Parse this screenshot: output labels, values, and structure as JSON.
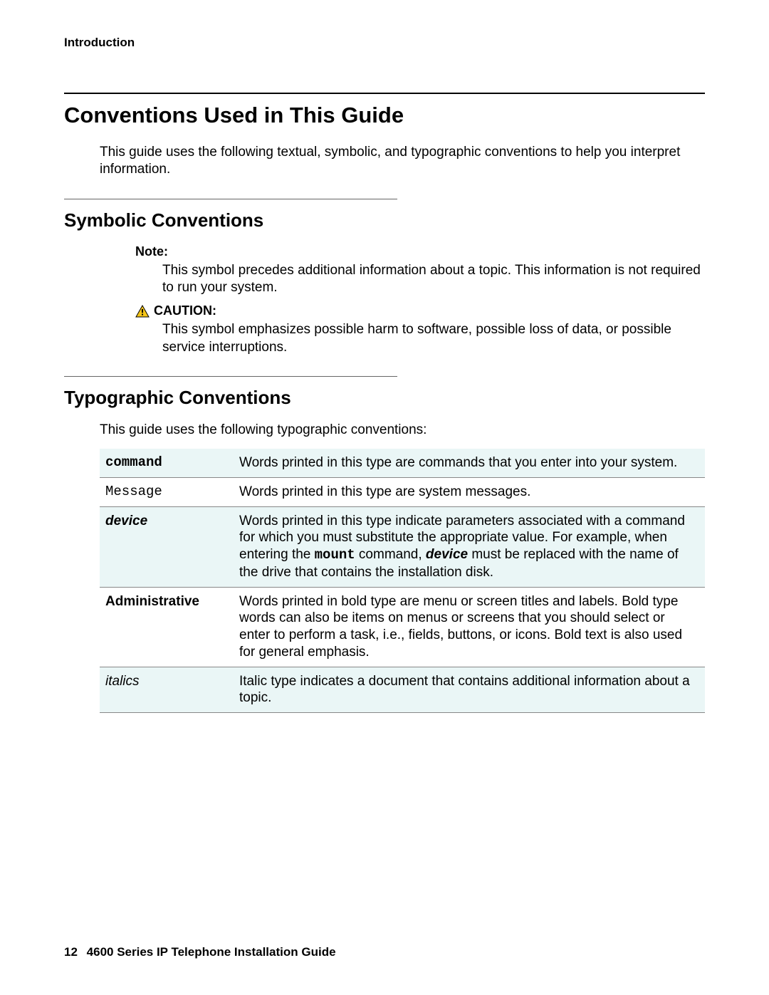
{
  "header": {
    "running": "Introduction"
  },
  "section": {
    "title": "Conventions Used in This Guide",
    "intro": "This guide uses the following textual, symbolic, and typographic conventions to help you interpret information."
  },
  "symbolic": {
    "title": "Symbolic Conventions",
    "note": {
      "label": "Note:",
      "text": "This symbol precedes additional information about a topic. This information is not required to run your system."
    },
    "caution": {
      "label": "CAUTION:",
      "text": "This symbol emphasizes possible harm to software, possible loss of data, or possible service interruptions."
    }
  },
  "typographic": {
    "title": "Typographic Conventions",
    "intro": "This guide uses the following typographic conventions:",
    "rows": [
      {
        "term": "command",
        "desc": "Words printed in this type are commands that you enter into your system."
      },
      {
        "term": "Message",
        "desc": "Words printed in this type are system messages."
      },
      {
        "term": "device",
        "desc_pre": "Words printed in this type indicate parameters associated with a command for which you must substitute the appropriate value. For example, when entering the ",
        "desc_cmd": "mount",
        "desc_mid": " command, ",
        "desc_dev": "device",
        "desc_post": " must be replaced with the name of the drive that contains the installation disk."
      },
      {
        "term": "Administrative",
        "desc": "Words printed in bold type are menu or screen titles and labels. Bold type words can also be items on menus or screens that you should select or enter to perform a task, i.e., fields, buttons, or icons. Bold text is also used for general emphasis."
      },
      {
        "term": "italics",
        "desc": "Italic type indicates a document that contains additional information about a topic."
      }
    ]
  },
  "footer": {
    "page": "12",
    "title": "4600 Series IP Telephone Installation Guide"
  }
}
